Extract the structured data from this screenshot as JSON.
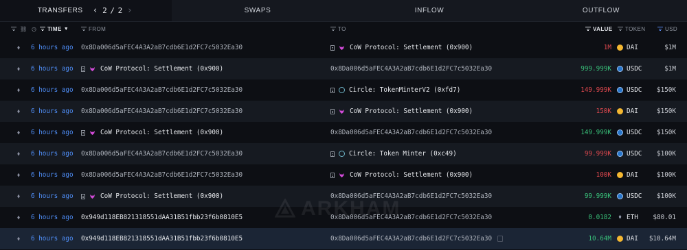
{
  "tabs": [
    {
      "label": "TRANSFERS",
      "active": true
    },
    {
      "label": "SWAPS"
    },
    {
      "label": "INFLOW"
    },
    {
      "label": "OUTFLOW"
    }
  ],
  "pager": {
    "current": "2",
    "sep": "/",
    "total": "2"
  },
  "columns": {
    "time": "TIME",
    "from": "FROM",
    "to": "TO",
    "value": "VALUE",
    "token": "TOKEN",
    "usd": "USD"
  },
  "watermark": "ARKHAM",
  "rows": [
    {
      "time": "6 hours ago",
      "from": "0x8Da006d5aFEC4A3A2aB7cdb6E1d2FC7c5032Ea30",
      "to": "CoW Protocol: Settlement (0x900)",
      "value": "1M",
      "token": "DAI",
      "usd": "$1M"
    },
    {
      "time": "6 hours ago",
      "from": "CoW Protocol: Settlement (0x900)",
      "to": "0x8Da006d5aFEC4A3A2aB7cdb6E1d2FC7c5032Ea30",
      "value": "999.999K",
      "token": "USDC",
      "usd": "$1M"
    },
    {
      "time": "6 hours ago",
      "from": "0x8Da006d5aFEC4A3A2aB7cdb6E1d2FC7c5032Ea30",
      "to": "Circle: TokenMinterV2 (0xfd7)",
      "value": "149.999K",
      "token": "USDC",
      "usd": "$150K"
    },
    {
      "time": "6 hours ago",
      "from": "0x8Da006d5aFEC4A3A2aB7cdb6E1d2FC7c5032Ea30",
      "to": "CoW Protocol: Settlement (0x900)",
      "value": "150K",
      "token": "DAI",
      "usd": "$150K"
    },
    {
      "time": "6 hours ago",
      "from": "CoW Protocol: Settlement (0x900)",
      "to": "0x8Da006d5aFEC4A3A2aB7cdb6E1d2FC7c5032Ea30",
      "value": "149.999K",
      "token": "USDC",
      "usd": "$150K"
    },
    {
      "time": "6 hours ago",
      "from": "0x8Da006d5aFEC4A3A2aB7cdb6E1d2FC7c5032Ea30",
      "to": "Circle: Token Minter (0xc49)",
      "value": "99.999K",
      "token": "USDC",
      "usd": "$100K"
    },
    {
      "time": "6 hours ago",
      "from": "0x8Da006d5aFEC4A3A2aB7cdb6E1d2FC7c5032Ea30",
      "to": "CoW Protocol: Settlement (0x900)",
      "value": "100K",
      "token": "DAI",
      "usd": "$100K"
    },
    {
      "time": "6 hours ago",
      "from": "CoW Protocol: Settlement (0x900)",
      "to": "0x8Da006d5aFEC4A3A2aB7cdb6E1d2FC7c5032Ea30",
      "value": "99.999K",
      "token": "USDC",
      "usd": "$100K"
    },
    {
      "time": "6 hours ago",
      "from": "0x949d118EB821318551dAA31B51fbb23f6b0810E5",
      "to": "0x8Da006d5aFEC4A3A2aB7cdb6E1d2FC7c5032Ea30",
      "value": "0.0182",
      "token": "ETH",
      "usd": "$80.01"
    },
    {
      "time": "6 hours ago",
      "from": "0x949d118EB821318551dAA31B51fbb23f6b0810E5",
      "to": "0x8Da006d5aFEC4A3A2aB7cdb6E1d2FC7c5032Ea30",
      "value": "10.64M",
      "token": "DAI",
      "usd": "$10.64M"
    }
  ]
}
